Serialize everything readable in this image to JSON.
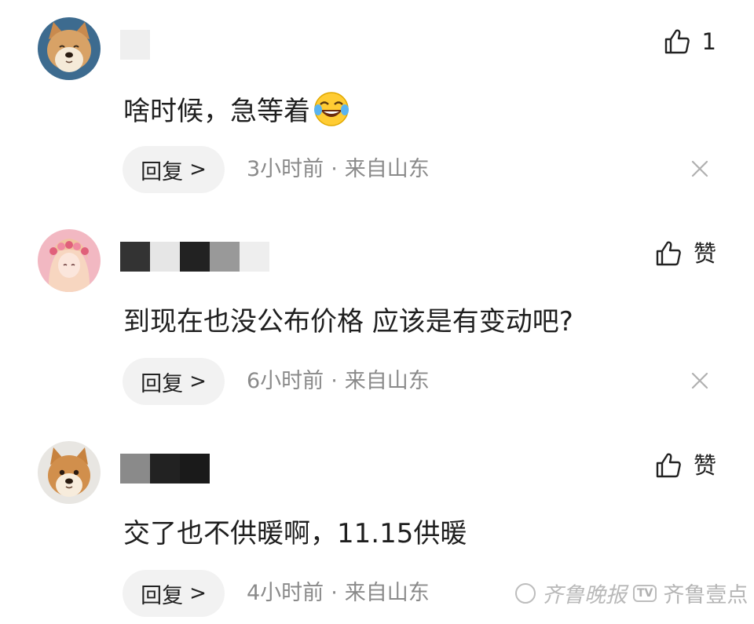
{
  "comments": [
    {
      "avatar": "shiba-dog-avatar",
      "likes": "1",
      "text": "啥时候，急等着",
      "has_emoji": true,
      "emoji": "laughing-crying-emoji",
      "reply_label": "回复",
      "time": "3小时前",
      "separator": "·",
      "location": "来自山东",
      "show_close": true
    },
    {
      "avatar": "anime-girl-avatar",
      "likes": "赞",
      "text": "到现在也没公布价格 应该是有变动吧?",
      "has_emoji": false,
      "reply_label": "回复",
      "time": "6小时前",
      "separator": "·",
      "location": "来自山东",
      "show_close": true
    },
    {
      "avatar": "shiba-dog-avatar-2",
      "likes": "赞",
      "text": "交了也不供暖啊，11.15供暖",
      "has_emoji": false,
      "reply_label": "回复",
      "time": "4小时前",
      "separator": "·",
      "location": "来自山东",
      "show_close": false
    }
  ],
  "watermark": {
    "newspaper": "齐鲁晚报",
    "tv": "TV",
    "brand": "齐鲁壹点"
  },
  "colors": {
    "text": "#1f1f1f",
    "meta": "#8a8a8a",
    "reply_bg": "#f2f2f2",
    "watermark": "#b9b9b9"
  }
}
